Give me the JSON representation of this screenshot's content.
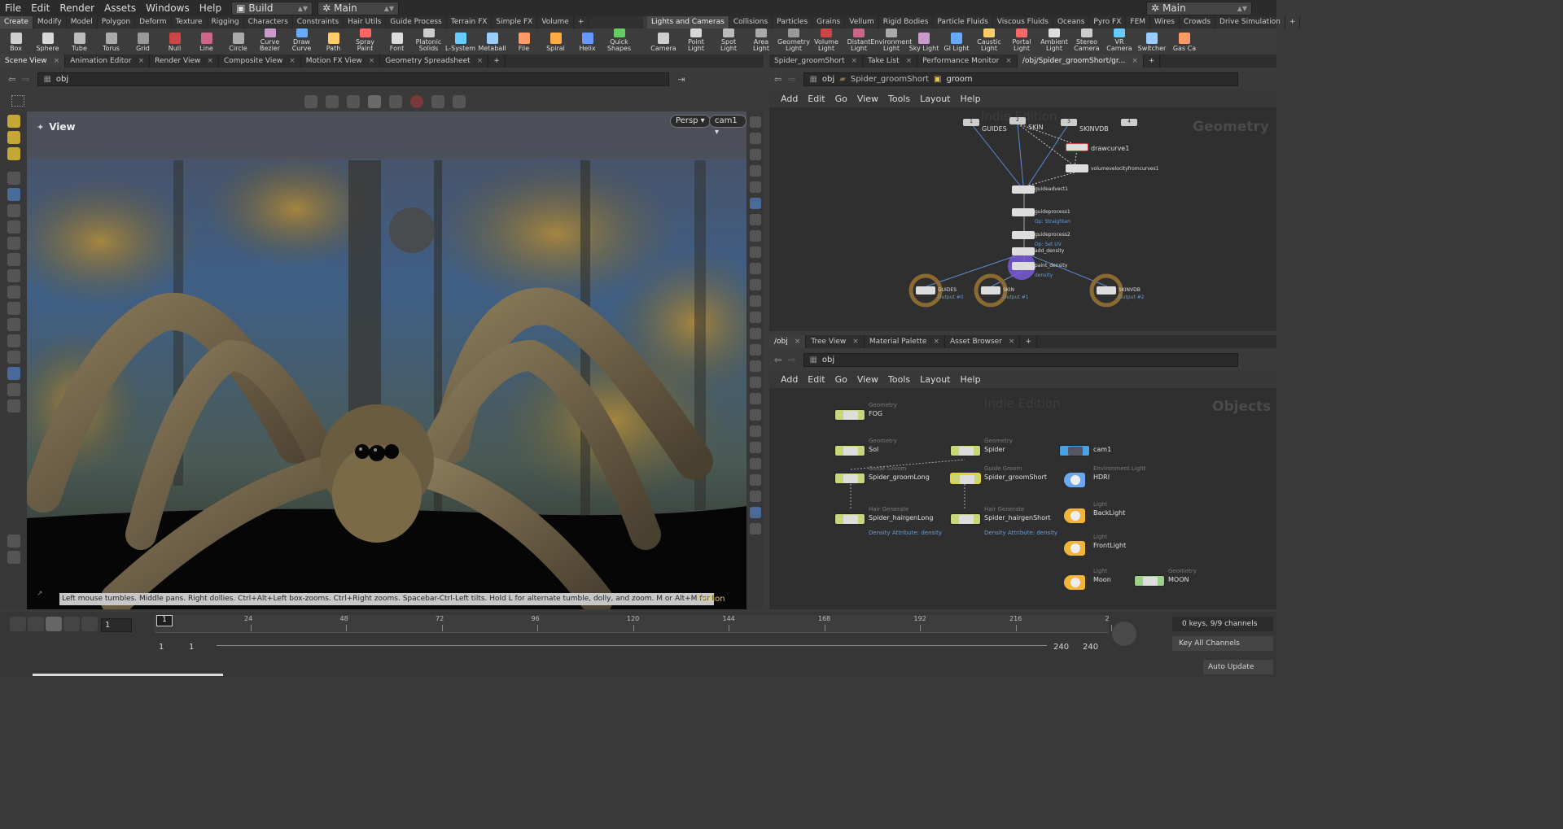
{
  "menubar": {
    "items": [
      "File",
      "Edit",
      "Render",
      "Assets",
      "Windows",
      "Help"
    ],
    "desktop": "Build",
    "context": "Main",
    "right_context": "Main"
  },
  "shelf_tabs_left": [
    "Create",
    "Modify",
    "Model",
    "Polygon",
    "Deform",
    "Texture",
    "Rigging",
    "Characters",
    "Constraints",
    "Hair Utils",
    "Guide Process",
    "Terrain FX",
    "Simple FX",
    "Volume"
  ],
  "shelf_tabs_right": [
    "Lights and Cameras",
    "Collisions",
    "Particles",
    "Grains",
    "Vellum",
    "Rigid Bodies",
    "Particle Fluids",
    "Viscous Fluids",
    "Oceans",
    "Pyro FX",
    "FEM",
    "Wires",
    "Crowds",
    "Drive Simulation"
  ],
  "shelf_tools_left": [
    "Box",
    "Sphere",
    "Tube",
    "Torus",
    "Grid",
    "Null",
    "Line",
    "Circle",
    "Curve Bezier",
    "Draw Curve",
    "Path",
    "Spray Paint",
    "Font",
    "Platonic Solids",
    "L-System",
    "Metaball",
    "File",
    "Spiral",
    "Helix",
    "Quick Shapes"
  ],
  "shelf_tools_right": [
    "Camera",
    "Point Light",
    "Spot Light",
    "Area Light",
    "Geometry Light",
    "Volume Light",
    "Distant Light",
    "Environment Light",
    "Sky Light",
    "GI Light",
    "Caustic Light",
    "Portal Light",
    "Ambient Light",
    "Stereo Camera",
    "VR Camera",
    "Switcher",
    "Gas Ca"
  ],
  "pane_tabs_left": [
    "Scene View",
    "Animation Editor",
    "Render View",
    "Composite View",
    "Motion FX View",
    "Geometry Spreadsheet"
  ],
  "pane_tabs_right_top": [
    "Spider_groomShort",
    "Take List",
    "Performance Monitor",
    "/obj/Spider_groomShort/gr..."
  ],
  "pane_tabs_right_bottom": [
    "/obj",
    "Tree View",
    "Material Palette",
    "Asset Browser"
  ],
  "scene_view": {
    "path": "obj",
    "title": "View",
    "persp": "Persp",
    "camera": "cam1",
    "hint": "Left mouse tumbles. Middle pans. Right dollies. Ctrl+Alt+Left box-zooms. Ctrl+Right zooms. Spacebar-Ctrl-Left tilts. Hold L for alternate tumble, dolly, and zoom. M or Alt+M for First Person Navigation.",
    "edition": "Indie Edition"
  },
  "net_top": {
    "path": [
      "obj",
      "Spider_groomShort",
      "groom"
    ],
    "menu": [
      "Add",
      "Edit",
      "Go",
      "View",
      "Tools",
      "Layout",
      "Help"
    ],
    "watermark": "Indie Edition",
    "context_label": "Geometry",
    "inputs": [
      {
        "num": "1",
        "label": "GUIDES"
      },
      {
        "num": "2",
        "label": "SKIN"
      },
      {
        "num": "3",
        "label": "SKINVDB"
      },
      {
        "num": "4",
        "label": ""
      }
    ],
    "nodes": [
      "drawcurve1",
      "volumevelocityfromcurves1",
      "guideadvect1",
      "guideprocess1",
      "guideprocess2",
      "add_density",
      "paint_density"
    ],
    "node_subs": [
      "Op: Straighten",
      "Op: Set UV",
      "density"
    ],
    "outputs": [
      {
        "label": "GUIDES",
        "sub": "Output #0"
      },
      {
        "label": "SKIN",
        "sub": "Output #1"
      },
      {
        "label": "SKINVDB",
        "sub": "Output #2"
      }
    ]
  },
  "net_bottom": {
    "path": "obj",
    "menu": [
      "Add",
      "Edit",
      "Go",
      "View",
      "Tools",
      "Layout",
      "Help"
    ],
    "watermark": "Indie Edition",
    "context_label": "Objects",
    "objects": [
      {
        "type": "Geometry",
        "name": "FOG"
      },
      {
        "type": "Geometry",
        "name": "Sol"
      },
      {
        "type": "Geometry",
        "name": "Spider"
      },
      {
        "type": "",
        "name": "cam1"
      },
      {
        "type": "Guide Groom",
        "name": "Spider_groomLong"
      },
      {
        "type": "Guide Groom",
        "name": "Spider_groomShort"
      },
      {
        "type": "Environment Light",
        "name": "HDRI"
      },
      {
        "type": "Hair Generate",
        "name": "Spider_hairgenLong",
        "attr": "Density Attribute: density"
      },
      {
        "type": "Hair Generate",
        "name": "Spider_hairgenShort",
        "attr": "Density Attribute: density"
      },
      {
        "type": "Light",
        "name": "BackLight"
      },
      {
        "type": "Light",
        "name": "FrontLight"
      },
      {
        "type": "Light",
        "name": "Moon"
      },
      {
        "type": "Geometry",
        "name": "MOON"
      }
    ]
  },
  "timeline": {
    "current_frame": "1",
    "frame_marker": "1",
    "ticks": [
      "24",
      "48",
      "72",
      "96",
      "120",
      "144",
      "168",
      "192",
      "216",
      "2"
    ],
    "start": "1",
    "start2": "1",
    "end": "240",
    "end2": "240",
    "keys_info": "0 keys, 9/9 channels",
    "key_mode": "Key All Channels",
    "update_mode": "Auto Update"
  },
  "colors": {
    "accent_yellow": "#e8c84a",
    "node_blue_link": "#5a8bd6",
    "geo_node": "#c8d67a",
    "light_node": "#f2b43a",
    "cam_node": "#4aa0e0"
  }
}
